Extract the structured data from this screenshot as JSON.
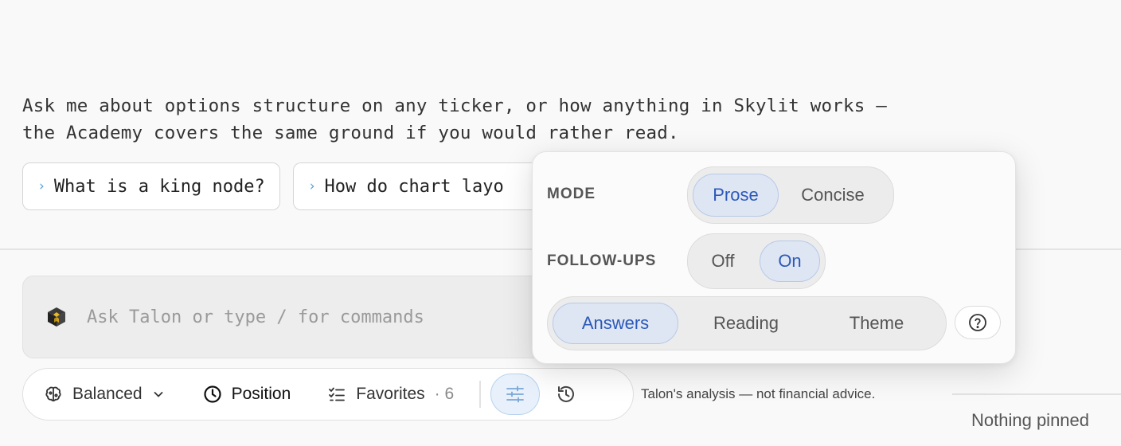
{
  "intro": {
    "line1": "Ask me about options structure on any ticker, or how anything in Skylit works —",
    "line2": "the Academy covers the same ground if you would rather read."
  },
  "suggestions": [
    {
      "label": "What is a king node?"
    },
    {
      "label": "How do chart layo"
    }
  ],
  "composer": {
    "placeholder": "Ask Talon or type / for commands",
    "value": ""
  },
  "toolbar": {
    "balanced_label": "Balanced",
    "position_label": "Position",
    "favorites_label": "Favorites",
    "favorites_count": "· 6"
  },
  "disclaimer": "Talon's analysis — not financial advice.",
  "pinned": "Nothing pinned",
  "popover": {
    "mode_label": "MODE",
    "mode_options": [
      "Prose",
      "Concise"
    ],
    "mode_selected": "Prose",
    "followups_label": "FOLLOW-UPS",
    "followups_options": [
      "Off",
      "On"
    ],
    "followups_selected": "On",
    "tabs": [
      "Answers",
      "Reading",
      "Theme"
    ],
    "tab_selected": "Answers"
  },
  "colors": {
    "accent": "#2c59b8",
    "accent_bg": "#dfe6f3",
    "chip_chevron": "#5aa0d8"
  },
  "icons": [
    "brain-icon",
    "chevron-down-icon",
    "clock-icon",
    "checklist-icon",
    "sliders-icon",
    "history-icon",
    "help-icon",
    "talon-cube-icon"
  ]
}
